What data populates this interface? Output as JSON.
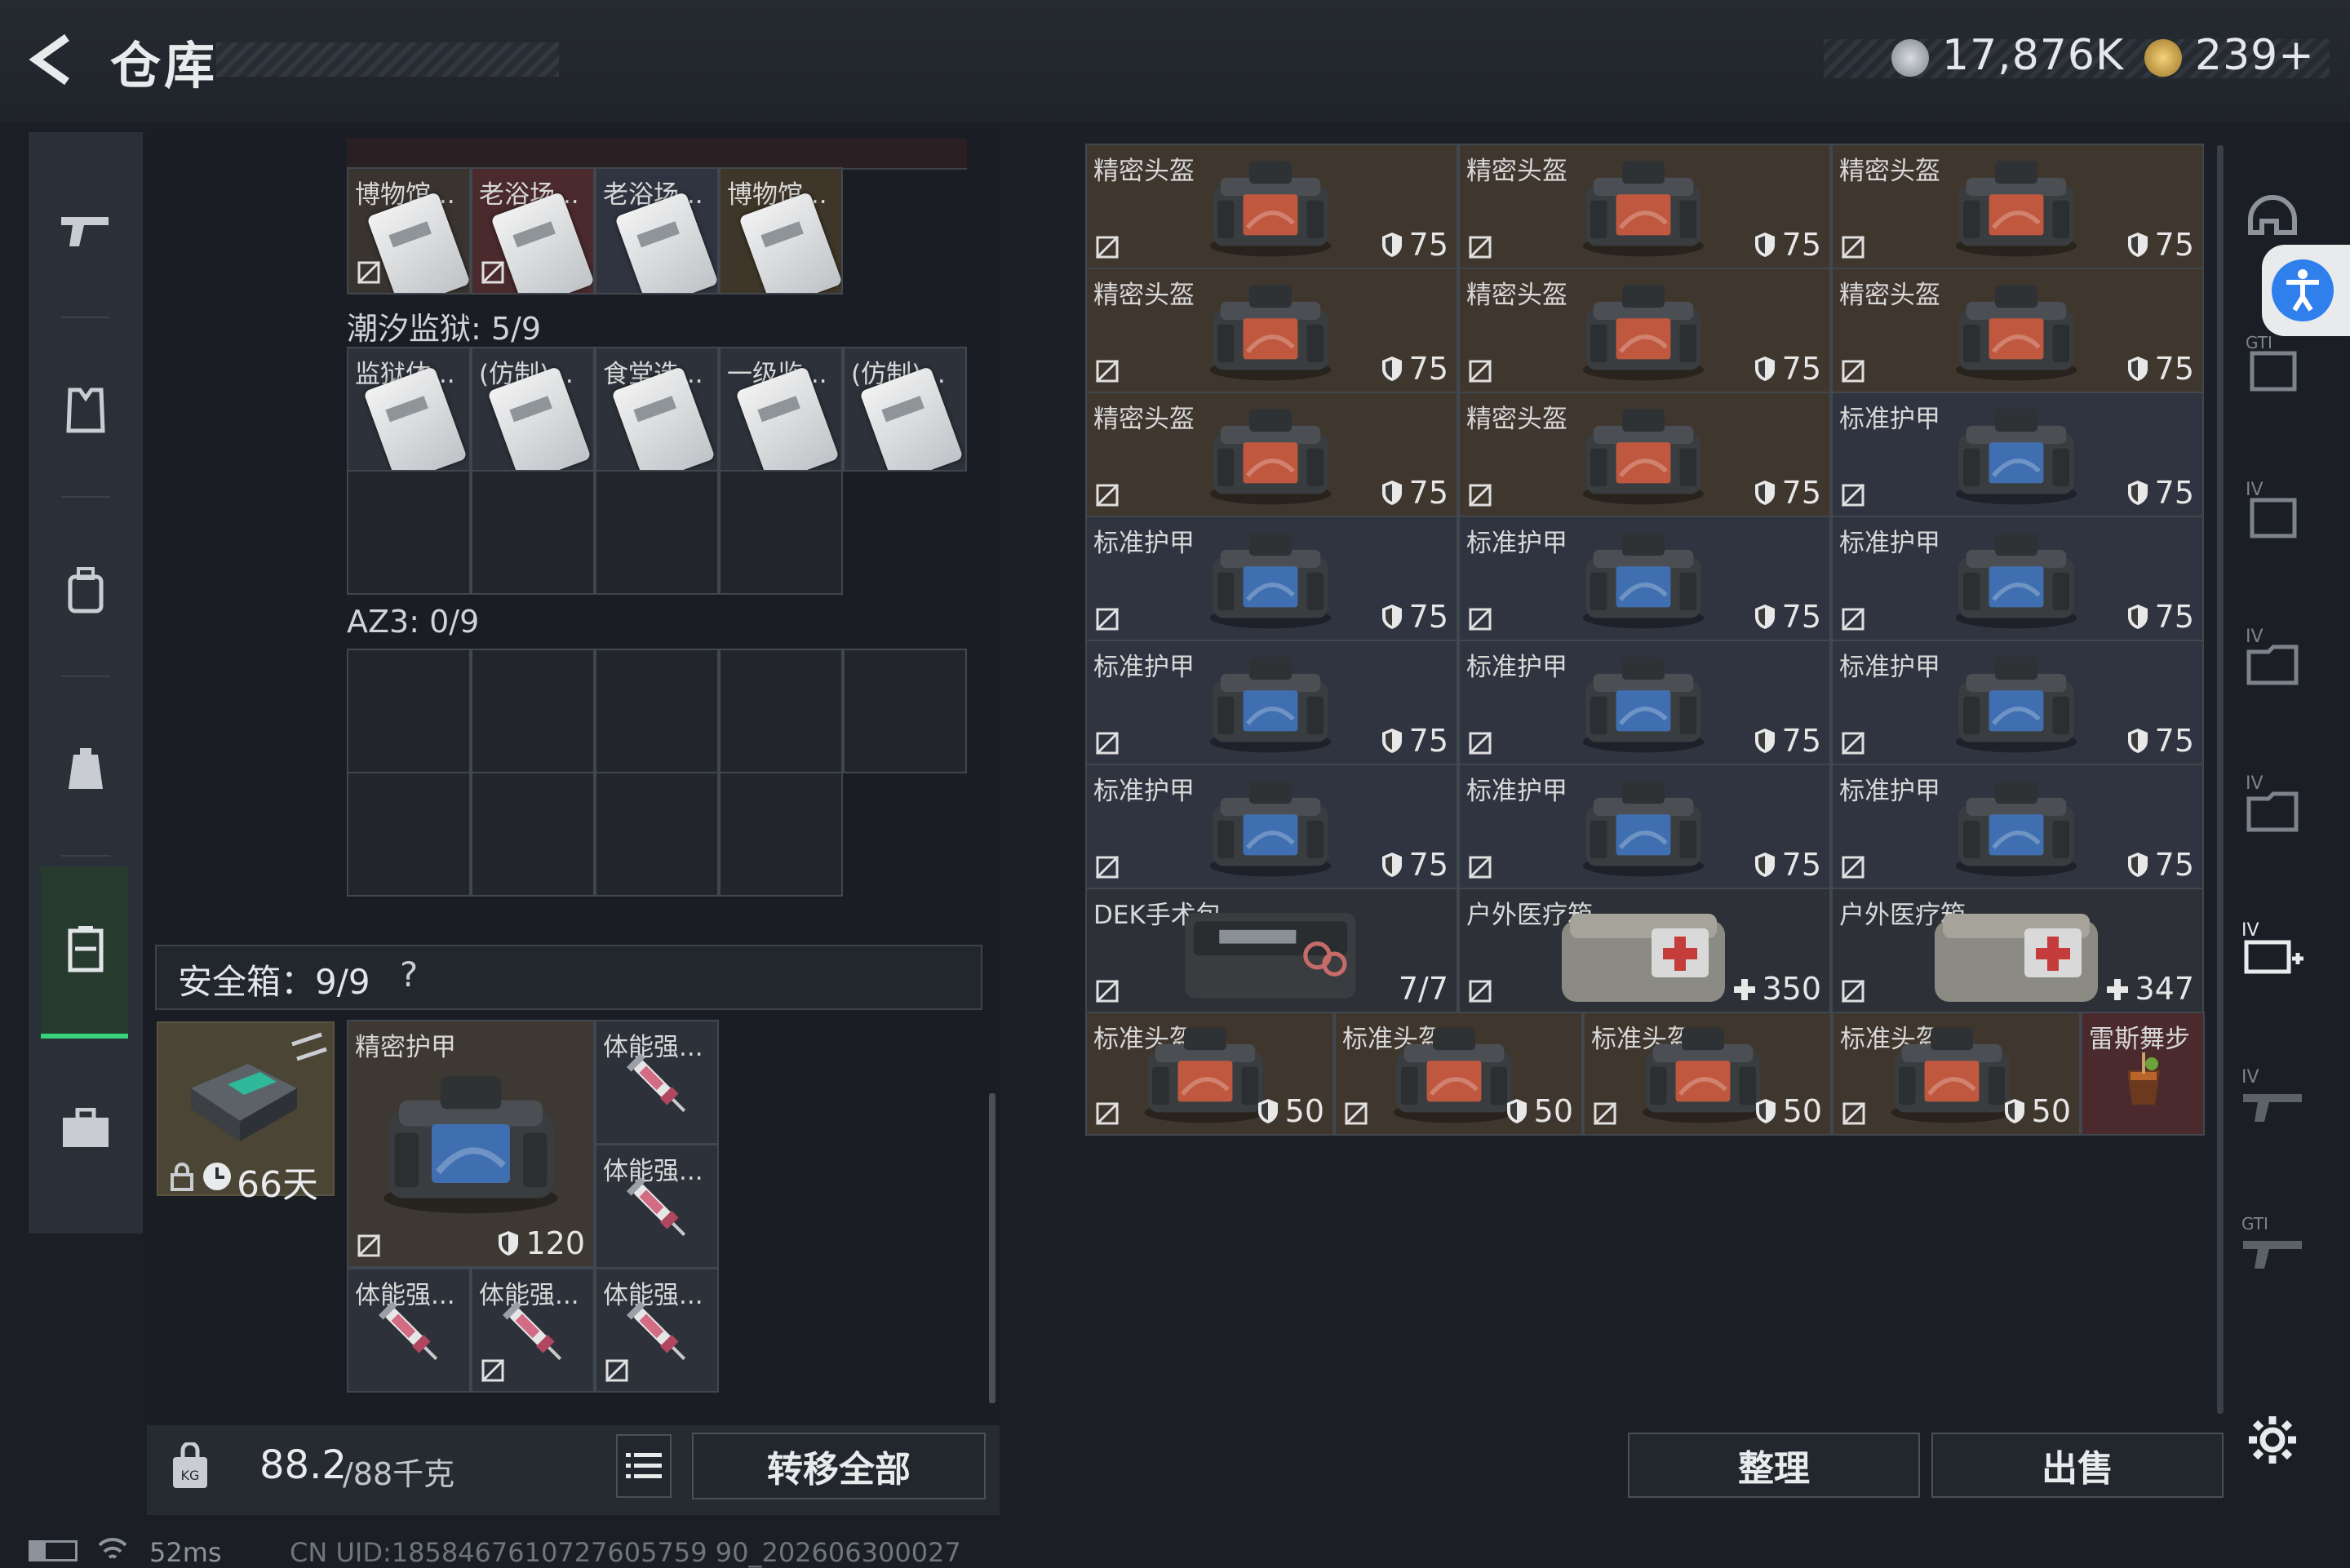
{
  "header": {
    "title": "仓库",
    "currency_1": "17,876K",
    "currency_2": "239+"
  },
  "nav": {
    "items": [
      "weapon-icon",
      "armor-vest-icon",
      "backpack-icon",
      "helmet-icon",
      "container-icon",
      "briefcase-icon"
    ]
  },
  "left": {
    "top_row_cells": [
      {
        "name": "博物馆...",
        "bg": "#3a3430"
      },
      {
        "name": "老浴场...",
        "bg": "#4a2a2c"
      },
      {
        "name": "老浴场...",
        "bg": "#2f3440"
      },
      {
        "name": "博物馆...",
        "bg": "#3e3628"
      }
    ],
    "prison_label": "潮汐监狱: 5/9",
    "prison_cells": [
      {
        "name": "监狱体..."
      },
      {
        "name": "(仿制)..."
      },
      {
        "name": "食堂选..."
      },
      {
        "name": "一级监..."
      },
      {
        "name": "(仿制)..."
      }
    ],
    "az3_label": "AZ3: 0/9",
    "safe_label": "安全箱：9/9",
    "safe_help": "?",
    "safe_days": "66天",
    "safe_items": {
      "big": {
        "name": "精密护甲",
        "value": "120"
      },
      "small": [
        "体能强...",
        "体能强...",
        "体能强...",
        "体能强...",
        "体能强..."
      ]
    },
    "weight": "88.2",
    "weight_max": "/88千克",
    "transfer_all": "转移全部"
  },
  "right": {
    "rows": [
      [
        {
          "name": "精密头盔",
          "val": "75",
          "kind": "helmet"
        },
        {
          "name": "精密头盔",
          "val": "75",
          "kind": "helmet"
        },
        {
          "name": "精密头盔",
          "val": "75",
          "kind": "helmet"
        }
      ],
      [
        {
          "name": "精密头盔",
          "val": "75",
          "kind": "helmet"
        },
        {
          "name": "精密头盔",
          "val": "75",
          "kind": "helmet"
        },
        {
          "name": "精密头盔",
          "val": "75",
          "kind": "helmet"
        }
      ],
      [
        {
          "name": "精密头盔",
          "val": "75",
          "kind": "helmet"
        },
        {
          "name": "精密头盔",
          "val": "75",
          "kind": "helmet"
        },
        {
          "name": "标准护甲",
          "val": "75",
          "kind": "armor"
        }
      ],
      [
        {
          "name": "标准护甲",
          "val": "75",
          "kind": "armor"
        },
        {
          "name": "标准护甲",
          "val": "75",
          "kind": "armor"
        },
        {
          "name": "标准护甲",
          "val": "75",
          "kind": "armor"
        }
      ],
      [
        {
          "name": "标准护甲",
          "val": "75",
          "kind": "armor"
        },
        {
          "name": "标准护甲",
          "val": "75",
          "kind": "armor"
        },
        {
          "name": "标准护甲",
          "val": "75",
          "kind": "armor"
        }
      ],
      [
        {
          "name": "标准护甲",
          "val": "75",
          "kind": "armor"
        },
        {
          "name": "标准护甲",
          "val": "75",
          "kind": "armor"
        },
        {
          "name": "标准护甲",
          "val": "75",
          "kind": "armor"
        }
      ]
    ],
    "medkit_row": [
      {
        "name": "DEK手术包",
        "val": "7/7",
        "kind": "kit"
      },
      {
        "name": "户外医疗箱",
        "val": "350",
        "kind": "med"
      },
      {
        "name": "户外医疗箱",
        "val": "347",
        "kind": "med"
      }
    ],
    "last_row": [
      {
        "name": "标准头盔",
        "val": "50"
      },
      {
        "name": "标准头盔",
        "val": "50"
      },
      {
        "name": "标准头盔",
        "val": "50"
      },
      {
        "name": "标准头盔",
        "val": "50"
      },
      {
        "name": "雷斯舞步",
        "val": ""
      }
    ],
    "sort_btn": "整理",
    "sell_btn": "出售"
  },
  "footer": {
    "ping": "52ms",
    "uid": "CN UID:1858467610727605759 90_202606300027"
  }
}
